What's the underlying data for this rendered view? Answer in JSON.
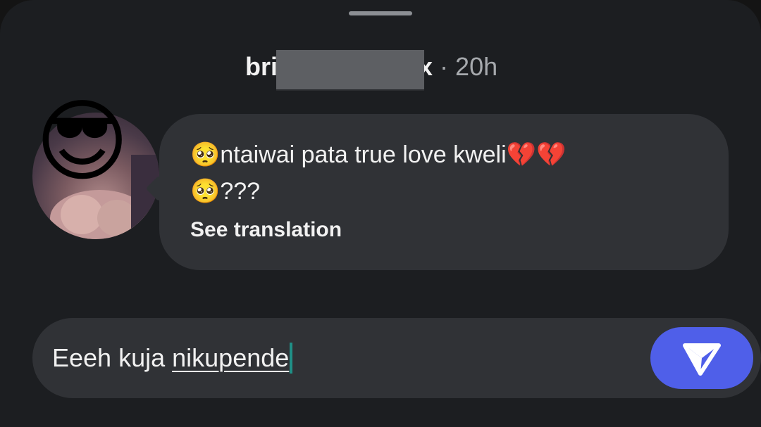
{
  "header": {
    "username_start": "bri",
    "username_end": "x",
    "separator": "·",
    "timestamp": "20h"
  },
  "avatar": {
    "overlay_emoji": "😎"
  },
  "message": {
    "line1": "🥺ntaiwai pata true love kweli💔💔",
    "line2": "🥺???",
    "translation_link": "See translation"
  },
  "composer": {
    "word_plain": "Eeeh kuja",
    "word_underlined": "nikupende",
    "send_icon": "send-plane-icon",
    "accent_color": "#4f5fe9"
  }
}
